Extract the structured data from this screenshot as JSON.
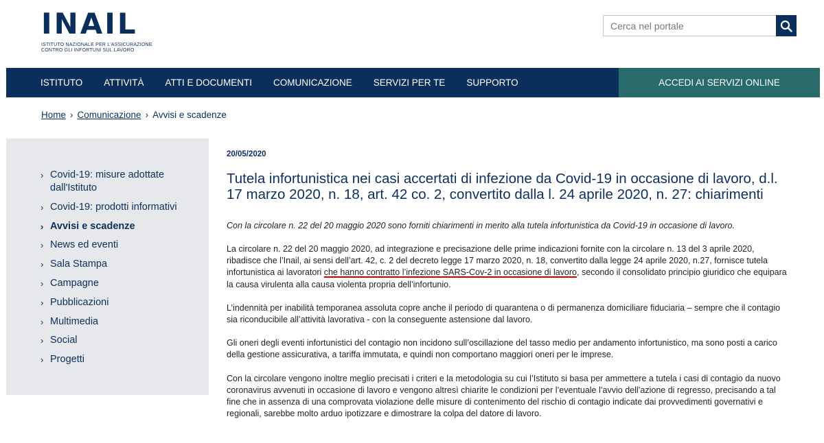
{
  "header": {
    "logo_text": "INAIL",
    "logo_subtitle_line1": "ISTITUTO NAZIONALE PER L'ASSICURAZIONE",
    "logo_subtitle_line2": "CONTRO GLI INFORTUNI SUL LAVORO",
    "search_placeholder": "Cerca nel portale",
    "search_icon": "search-icon"
  },
  "nav": {
    "items": [
      "ISTITUTO",
      "ATTIVITÀ",
      "ATTI E DOCUMENTI",
      "COMUNICAZIONE",
      "SERVIZI PER TE",
      "SUPPORTO"
    ],
    "cta": "ACCEDI AI SERVIZI ONLINE"
  },
  "breadcrumb": {
    "items": [
      "Home",
      "Comunicazione"
    ],
    "current": "Avvisi e scadenze",
    "separator": "›"
  },
  "sidebar": {
    "items": [
      {
        "label": "Covid-19: misure adottate dall'Istituto"
      },
      {
        "label": "Covid-19: prodotti informativi"
      },
      {
        "label": "Avvisi e scadenze"
      },
      {
        "label": "News ed eventi"
      },
      {
        "label": "Sala Stampa"
      },
      {
        "label": "Campagne"
      },
      {
        "label": "Pubblicazioni"
      },
      {
        "label": "Multimedia"
      },
      {
        "label": "Social"
      },
      {
        "label": "Progetti"
      }
    ],
    "chevron": "›"
  },
  "article": {
    "date": "20/05/2020",
    "title": "Tutela infortunistica nei casi accertati di infezione da Covid-19 in occasione di lavoro, d.l. 17 marzo 2020, n. 18, art. 42 co. 2, convertito dalla l. 24 aprile 2020, n. 27: chiarimenti",
    "lead": "Con la circolare n. 22 del 20 maggio 2020 sono forniti chiarimenti in merito alla tutela infortunistica da Covid-19 in occasione di lavoro.",
    "p1_before": "La circolare n. 22 del 20 maggio 2020, ad integrazione e precisazione delle prime indicazioni fornite con la circolare n. 13 del 3 aprile 2020, ribadisce che l’Inail, ai sensi dell’art. 42, c. 2 del decreto legge 17 marzo 2020, n. 18, convertito dalla legge 24 aprile 2020, n.27, fornisce tutela infortunistica ai lavoratori ",
    "p1_highlight": "che hanno contratto l’infezione SARS-Cov-2 in occasione di lavoro",
    "p1_after": ", secondo il consolidato principio giuridico che equipara  la causa virulenta alla causa violenta propria dell’infortunio.",
    "p2": "L’indennità per inabilità temporanea assoluta copre anche il periodo di quarantena o di permanenza domiciliare fiduciaria – sempre che il contagio sia riconducibile all’attività lavorativa - con la conseguente astensione dal lavoro.",
    "p3": "Gli oneri degli eventi infortunistici del contagio non incidono sull’oscillazione del tasso medio per andamento infortunistico, ma sono posti a carico della gestione assicurativa, a tariffa immutata, e quindi non comportano maggiori oneri per le imprese.",
    "p4": "Con la circolare vengono inoltre meglio precisati i criteri e la metodologia su cui l’Istituto si basa per ammettere a tutela i casi di contagio da nuovo coronavirus avvenuti in occasione di lavoro e vengono altresì chiarite le condizioni per l’eventuale l’avvio dell’azione di regresso, precisando a tal fine che in assenza di una comprovata violazione delle misure di contenimento del rischio di contagio indicate dai provvedimenti governativi e regionali, sarebbe molto arduo ipotizzare e dimostrare la colpa del datore di lavoro."
  },
  "colors": {
    "brand_navy": "#0b2f5b",
    "cta_teal": "#296a6a",
    "sidebar_bg": "#e6e8eb",
    "highlight_underline": "#d40000"
  }
}
